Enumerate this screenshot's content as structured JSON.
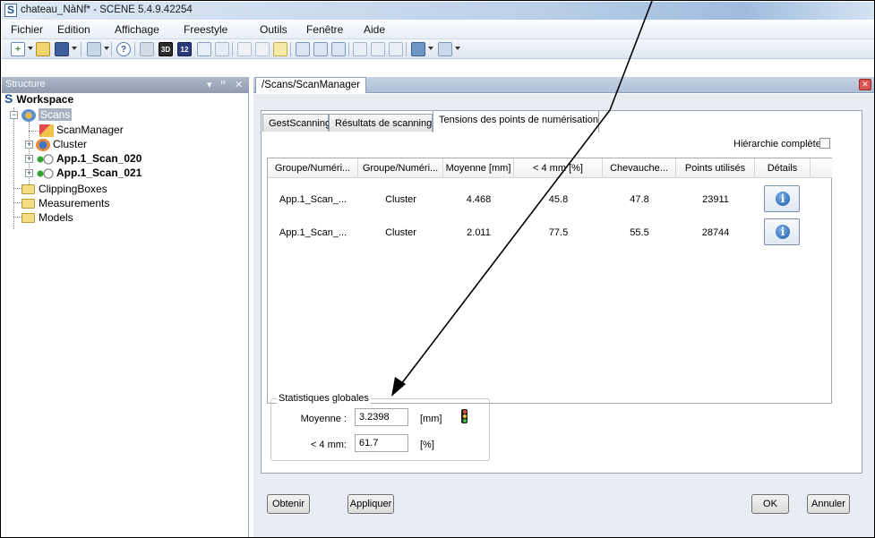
{
  "window": {
    "title": "chateau_NàNf* - SCENE 5.4.9.42254",
    "app_icon": "S"
  },
  "menu": [
    "Fichier",
    "Edition",
    "Affichage",
    "Freestyle",
    "Outils",
    "Fenêtre",
    "Aide"
  ],
  "toolbar": {
    "badge_3d": "3D",
    "badge_12": "12"
  },
  "structure_panel": {
    "title": "Structure",
    "header_icons": [
      "▾",
      "ꟸ",
      "✕"
    ],
    "workspace_label": "Workspace",
    "workspace_icon": "S",
    "tree": {
      "scans": "Scans",
      "scan_manager": "ScanManager",
      "cluster": "Cluster",
      "scan_020": "App.1_Scan_020",
      "scan_021": "App.1_Scan_021",
      "clipping_boxes": "ClippingBoxes",
      "measurements": "Measurements",
      "models": "Models"
    }
  },
  "document": {
    "tab_title": "/Scans/ScanManager",
    "close_glyph": "✕"
  },
  "tabs": [
    {
      "label": "GestScanning",
      "active": false
    },
    {
      "label": "Résultats de scanning",
      "active": false
    },
    {
      "label": "Tensions des points de numérisation",
      "active": true
    }
  ],
  "hierarchy": {
    "label": "Hiérarchie complète",
    "checked": false
  },
  "table": {
    "headers": [
      "Groupe/Numéri...",
      "Groupe/Numéri...",
      "Moyenne [mm]",
      "< 4 mm [%]",
      "Chevauche...",
      "Points utilisés",
      "Détails"
    ],
    "rows": [
      [
        "App.1_Scan_...",
        "Cluster",
        "4.468",
        "45.8",
        "47.8",
        "23911",
        "i"
      ],
      [
        "App.1_Scan_...",
        "Cluster",
        "2.011",
        "77.5",
        "55.5",
        "28744",
        "i"
      ]
    ]
  },
  "stats": {
    "title": "Statistiques globales",
    "mean_label": "Moyenne :",
    "mean_value": "3.2398",
    "mean_unit": "[mm]",
    "lt4_label": "< 4 mm:",
    "lt4_value": "61.7",
    "lt4_unit": "[%]"
  },
  "buttons": {
    "obtenir": "Obtenir",
    "appliquer": "Appliquer",
    "ok": "OK",
    "annuler": "Annuler"
  },
  "colors": {
    "accent": "#1f5aa8",
    "panel_header": "#8f9cb0",
    "close": "#d9534f"
  }
}
